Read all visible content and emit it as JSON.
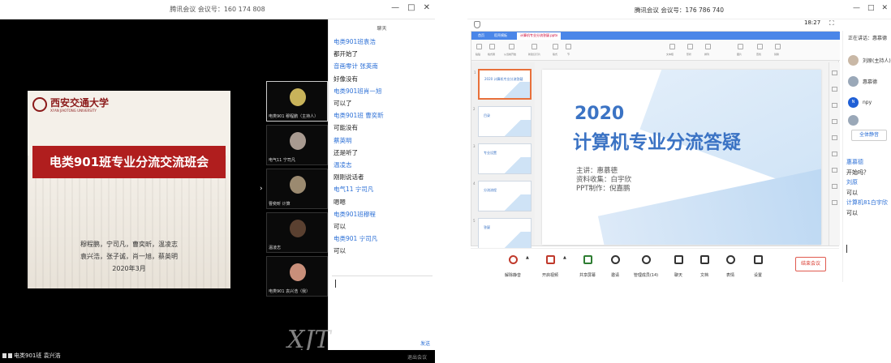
{
  "left_window": {
    "title": "腾讯会议 会议号：160 174 808",
    "controls": [
      "—",
      "□",
      "✕"
    ],
    "slide": {
      "logo_cn": "西安交通大学",
      "logo_en": "XI'AN JIAOTONG UNIVERSITY",
      "banner": "电类901班专业分流交流班会",
      "names_line1": "穆程鹏，宁司凡，曹奕昕，温凌志",
      "names_line2": "袁兴浩，张子诚，肖一旭，蔡英明",
      "date": "2020年3月"
    },
    "toggle_arrow": "›",
    "videos": [
      {
        "caption": "电类901  穆程鹏（主持人）",
        "face_color": "#c8b35a"
      },
      {
        "caption": "电气11 宁司凡",
        "face_color": "#a89a90"
      },
      {
        "caption": "曹奕昕 计算",
        "face_color": "#9b8a70"
      },
      {
        "caption": "温凌志",
        "face_color": "#5a4030"
      },
      {
        "caption": "电类901 袁兴浩（我）",
        "face_color": "#c98f7a"
      }
    ],
    "chat_header": "聊天",
    "chat": [
      {
        "kind": "name",
        "text": "电类901班袁浩"
      },
      {
        "kind": "text",
        "text": "都开始了"
      },
      {
        "kind": "name",
        "text": "音画零计 张英南"
      },
      {
        "kind": "text",
        "text": "好像没有"
      },
      {
        "kind": "name",
        "text": "电类901班肖一旭"
      },
      {
        "kind": "text",
        "text": "可以了"
      },
      {
        "kind": "name",
        "text": "电类901班 曹奕昕"
      },
      {
        "kind": "text",
        "text": "可能没有"
      },
      {
        "kind": "name",
        "text": "蔡英明"
      },
      {
        "kind": "text",
        "text": "还是听了"
      },
      {
        "kind": "name",
        "text": "温凌志"
      },
      {
        "kind": "text",
        "text": "刚刚说话者"
      },
      {
        "kind": "name",
        "text": "电气11 宁司凡"
      },
      {
        "kind": "text",
        "text": "嗯嗯"
      },
      {
        "kind": "name",
        "text": "电类901班穆程"
      },
      {
        "kind": "text",
        "text": "可以"
      },
      {
        "kind": "name",
        "text": "电类901 宁司凡"
      },
      {
        "kind": "text",
        "text": "可以"
      }
    ],
    "send_label": "发送",
    "bottom_label": "电类901班 袁兴浩",
    "footer_right": "退出会议",
    "watermark": "XJT"
  },
  "right_window": {
    "title": "腾讯会议 会议号：176 786 740",
    "controls": [
      "—",
      "□",
      "✕"
    ],
    "clock": "18:27",
    "expand": "⛶",
    "ppt_tabs": [
      "首页",
      "稻壳模板",
      "计算机专业分流答疑.pptx"
    ],
    "ribbon_labels": [
      "粘贴",
      "格式刷",
      "从当前开始",
      "新建幻灯片",
      "版式",
      "节",
      "文本框",
      "形状",
      "排列",
      "图片",
      "查找",
      "替换"
    ],
    "thumbnails": [
      {
        "num": "1",
        "title": "2020 计算机专业分流答疑"
      },
      {
        "num": "2",
        "title": "目录"
      },
      {
        "num": "3",
        "title": "专业设置"
      },
      {
        "num": "4",
        "title": "分流流程"
      },
      {
        "num": "5",
        "title": "答疑"
      }
    ],
    "slide": {
      "year": "2020",
      "title": "计算机专业分流答疑",
      "speaker": "主讲：惠慕德",
      "collector": "资料收集：白宇欣",
      "ppt_maker": "PPT制作：倪嘉鹏"
    },
    "toolbar": [
      {
        "label": "解除静音",
        "icon": "mic-muted-icon"
      },
      {
        "label": "开启视频",
        "icon": "camera-off-icon"
      },
      {
        "label": "共享屏幕",
        "icon": "screen-share-icon"
      },
      {
        "label": "邀请",
        "icon": "invite-icon"
      },
      {
        "label": "管理成员(14)",
        "icon": "members-icon"
      },
      {
        "label": "聊天",
        "icon": "chat-icon"
      },
      {
        "label": "文档",
        "icon": "document-icon"
      },
      {
        "label": "表情",
        "icon": "emoji-icon"
      },
      {
        "label": "设置",
        "icon": "settings-icon"
      }
    ],
    "end_meeting": "结束会议",
    "side": {
      "speaking": "正在讲话：惠慕德",
      "members": [
        {
          "name": "刘原(主持人)",
          "avatar": "photo"
        },
        {
          "name": "惠慕德",
          "avatar": "photo"
        },
        {
          "name": "npy",
          "avatar": "N"
        },
        {
          "name": "",
          "avatar": "photo"
        }
      ],
      "mute_all": "全体静音",
      "chat": [
        {
          "kind": "name",
          "text": "惠慕德"
        },
        {
          "kind": "text",
          "text": "开始吗？"
        },
        {
          "kind": "name",
          "text": "刘原"
        },
        {
          "kind": "text",
          "text": "可以"
        },
        {
          "kind": "name",
          "text": "计算机81白宇欣"
        },
        {
          "kind": "text",
          "text": "可以"
        }
      ]
    }
  },
  "colors": {
    "banner_red": "#b01e1e",
    "accent_blue": "#3b73c4",
    "chat_name_blue": "#2b6fd6",
    "end_red": "#d93a2f"
  }
}
